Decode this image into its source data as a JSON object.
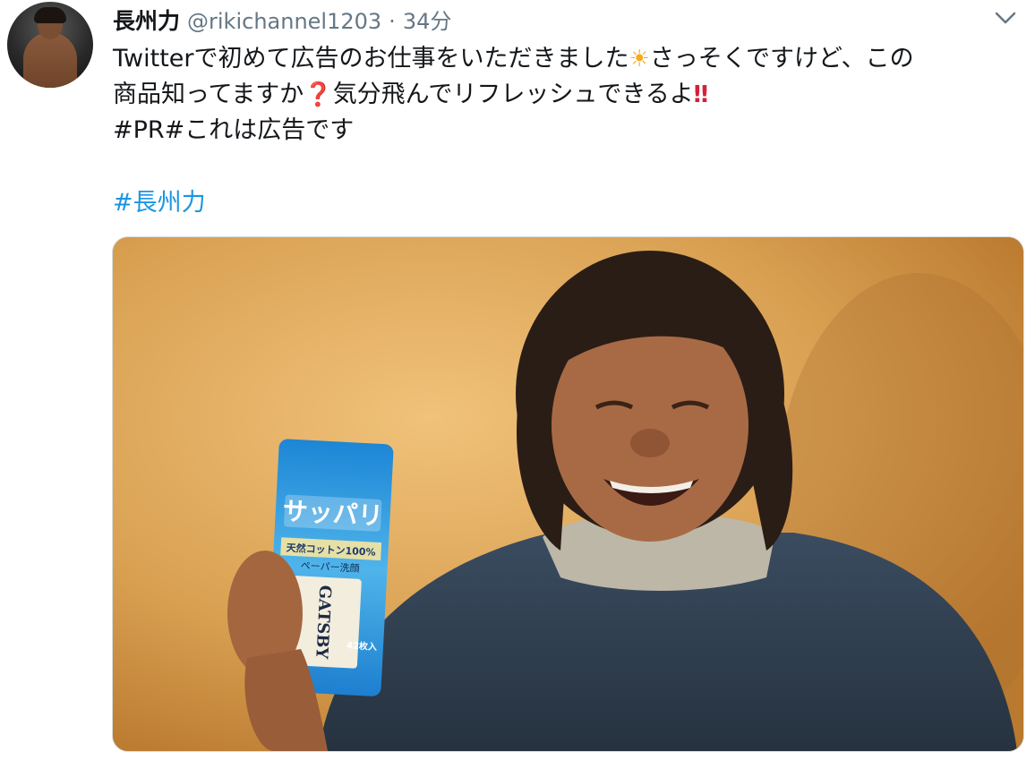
{
  "tweet": {
    "display_name": "長州力",
    "handle": "@rikichannel1203",
    "separator": "·",
    "time": "34分",
    "text_line1_a": "Twitterで初めて広告のお仕事をいただきました",
    "emoji_sun": "☀",
    "text_line1_b": "さっそくですけど、この",
    "text_line2_a": "商品知ってますか",
    "emoji_question": "❓",
    "text_line2_b": "気分飛んでリフレッシュできるよ",
    "emoji_exclaim": "‼",
    "text_line3": "#PR#これは広告です",
    "hashtag": "#長州力"
  },
  "product": {
    "brand": "GATSBY",
    "name": "サッパリ",
    "cotton": "天然コットン100%",
    "type": "ペーパー洗顔",
    "count": "42枚入"
  },
  "colors": {
    "link": "#1b95e0",
    "text": "#14171a",
    "muted": "#657786"
  }
}
